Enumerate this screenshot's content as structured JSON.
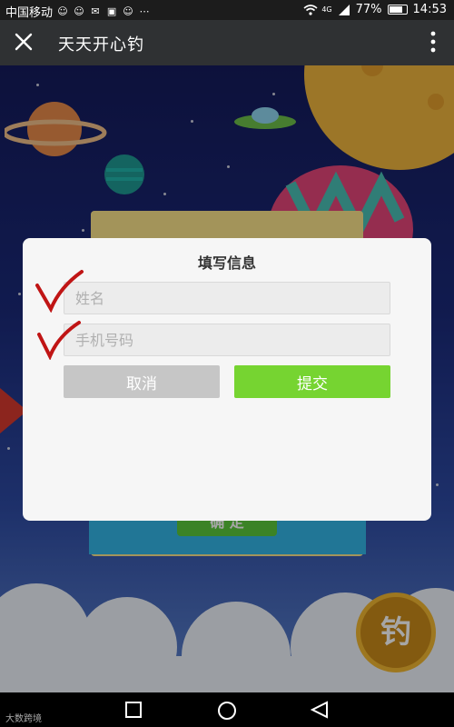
{
  "status_bar": {
    "carrier": "中国移动",
    "network": "4G",
    "battery_percent": "77%",
    "time": "14:53"
  },
  "title_bar": {
    "title": "天天开心钓"
  },
  "dialog": {
    "title": "填写信息",
    "name_placeholder": "姓名",
    "phone_placeholder": "手机号码",
    "cancel_label": "取消",
    "submit_label": "提交"
  },
  "background_button": {
    "label": "确 定",
    "fish_badge": "钓"
  },
  "watermark": "大数跨境",
  "colors": {
    "submit": "#76d431",
    "cancel": "#c6c6c6",
    "title_bar": "#2f3133"
  }
}
